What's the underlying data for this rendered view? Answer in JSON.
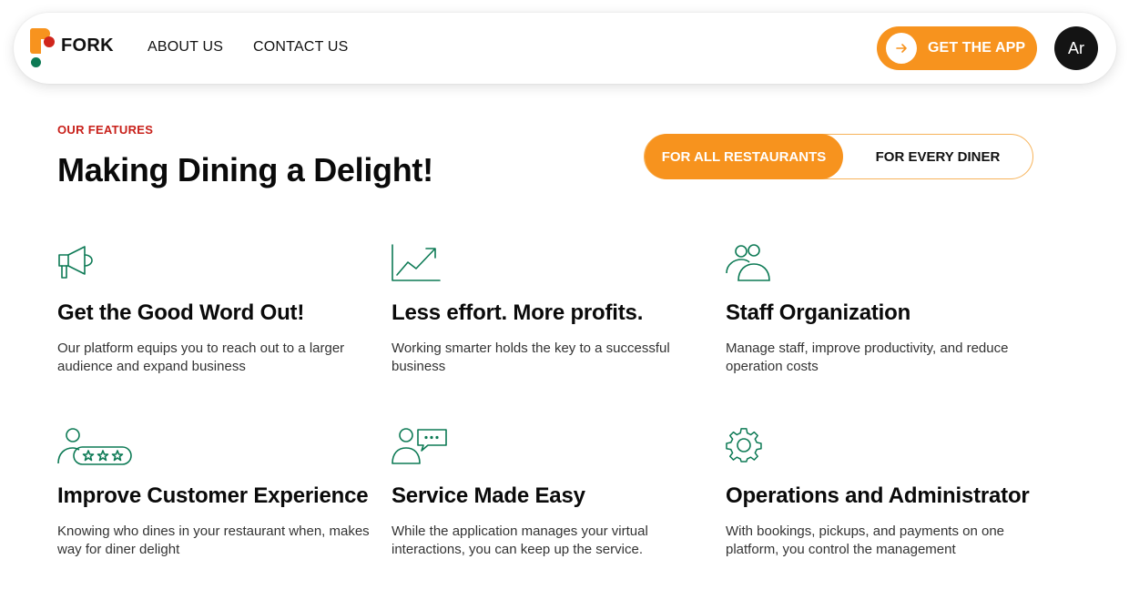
{
  "brand": {
    "name": "FORK",
    "orange": "#f7931e",
    "red": "#d0261c",
    "green": "#0d7a55"
  },
  "nav": {
    "links": [
      "ABOUT US",
      "CONTACT US"
    ],
    "cta_label": "GET THE APP",
    "cta_icon": "arrow-right-icon",
    "avatar_initials": "Ar"
  },
  "features_section": {
    "eyebrow": "OUR FEATURES",
    "headline": "Making Dining a Delight!",
    "toggle": {
      "active": "FOR ALL RESTAURANTS",
      "inactive": "FOR EVERY DINER"
    },
    "items": [
      {
        "icon": "megaphone-icon",
        "title": "Get the Good Word Out!",
        "desc": "Our platform equips you to reach out to a larger audience and expand business"
      },
      {
        "icon": "growth-chart-icon",
        "title": "Less effort. More profits.",
        "desc": "Working smarter holds the key to a successful business"
      },
      {
        "icon": "staff-group-icon",
        "title": "Staff Organization",
        "desc": "Manage staff, improve productivity, and reduce operation costs"
      },
      {
        "icon": "customer-rating-icon",
        "title": "Improve Customer Experience",
        "desc": "Knowing who dines in your restaurant when, makes way for diner delight"
      },
      {
        "icon": "chat-support-icon",
        "title": "Service Made Easy",
        "desc": "While the application manages your virtual interactions, you can keep up the service."
      },
      {
        "icon": "gear-icon",
        "title": "Operations and Administrator",
        "desc": "With bookings, pickups, and payments on one platform, you control the management"
      }
    ]
  }
}
